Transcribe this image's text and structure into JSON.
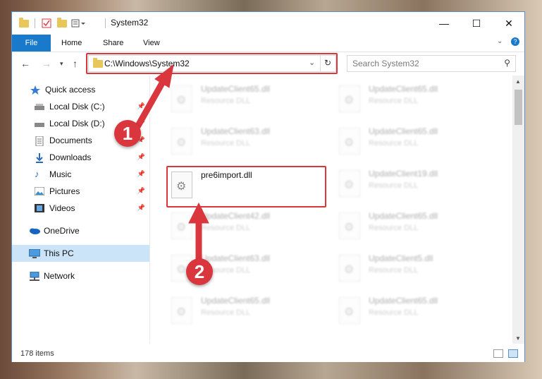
{
  "window": {
    "title": "System32",
    "controls": {
      "minimize": "—",
      "maximize": "☐",
      "close": "✕"
    }
  },
  "ribbon": {
    "tabs": [
      "File",
      "Home",
      "Share",
      "View"
    ],
    "expand_glyph": "⌄",
    "help_glyph": "?"
  },
  "address": {
    "path": "C:\\Windows\\System32",
    "search_placeholder": "Search System32"
  },
  "nav": {
    "items": [
      {
        "label": "Quick access",
        "icon": "star-icon",
        "pinned": false
      },
      {
        "label": "Local Disk (C:)",
        "icon": "drive-icon",
        "pinned": true
      },
      {
        "label": "Local Disk (D:)",
        "icon": "drive-icon",
        "pinned": true
      },
      {
        "label": "Documents",
        "icon": "documents-icon",
        "pinned": true
      },
      {
        "label": "Downloads",
        "icon": "download-icon",
        "pinned": true
      },
      {
        "label": "Music",
        "icon": "music-icon",
        "pinned": true
      },
      {
        "label": "Pictures",
        "icon": "pictures-icon",
        "pinned": true
      },
      {
        "label": "Videos",
        "icon": "videos-icon",
        "pinned": true
      },
      {
        "label": "OneDrive",
        "icon": "onedrive-icon",
        "pinned": false
      },
      {
        "label": "This PC",
        "icon": "computer-icon",
        "pinned": false
      },
      {
        "label": "Network",
        "icon": "network-icon",
        "pinned": false
      }
    ]
  },
  "files": {
    "highlighted": {
      "name": "pre6import.dll"
    },
    "blurred": [
      {
        "name": "UpdateClient65.dll",
        "type": "Resource DLL"
      },
      {
        "name": "UpdateClient65.dll",
        "type": "Resource DLL"
      },
      {
        "name": "UpdateClient63.dll",
        "type": "Resource DLL"
      },
      {
        "name": "UpdateClient65.dll",
        "type": "Resource DLL"
      },
      {
        "name": "UpdateClient19.dll",
        "type": "Resource DLL"
      },
      {
        "name": "UpdateClient42.dll",
        "type": "Resource DLL"
      },
      {
        "name": "UpdateClient65.dll",
        "type": "Resource DLL"
      },
      {
        "name": "UpdateClient63.dll",
        "type": "Resource DLL"
      },
      {
        "name": "UpdateClient5.dll",
        "type": "Resource DLL"
      },
      {
        "name": "UpdateClient65.dll",
        "type": "Resource DLL"
      },
      {
        "name": "UpdateClient65.dll",
        "type": "Resource DLL"
      }
    ]
  },
  "status": {
    "item_count": "178 items"
  },
  "annotations": {
    "step1": "1",
    "step2": "2",
    "color": "#d9363e"
  }
}
